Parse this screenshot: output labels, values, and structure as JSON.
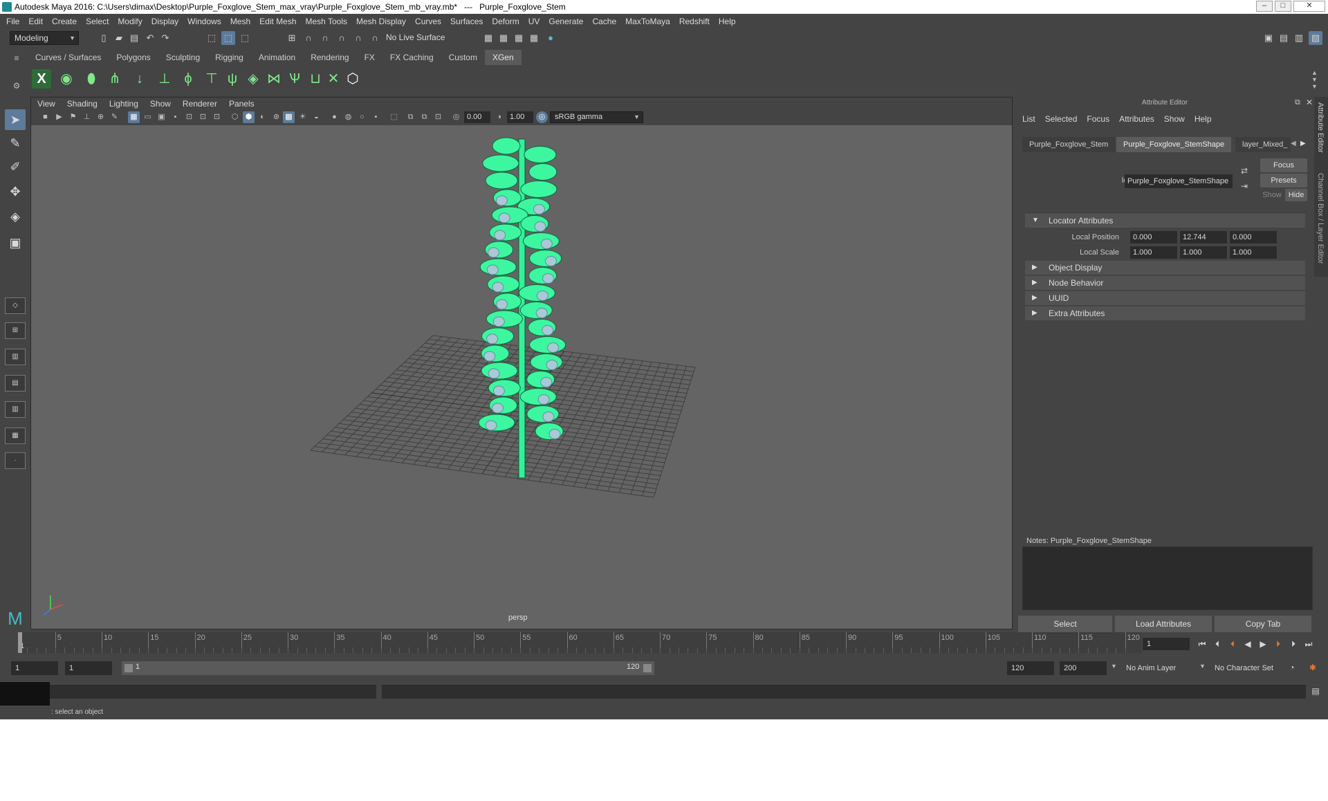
{
  "titlebar": {
    "title": "Autodesk Maya 2016: C:\\Users\\dimax\\Desktop\\Purple_Foxglove_Stem_max_vray\\Purple_Foxglove_Stem_mb_vray.mb*   ---   Purple_Foxglove_Stem",
    "minimize": "–",
    "maximize": "□",
    "close": "✕"
  },
  "menubar": {
    "items": [
      "File",
      "Edit",
      "Create",
      "Select",
      "Modify",
      "Display",
      "Windows",
      "Mesh",
      "Edit Mesh",
      "Mesh Tools",
      "Mesh Display",
      "Curves",
      "Surfaces",
      "Deform",
      "UV",
      "Generate",
      "Cache",
      "MaxToMaya",
      "Redshift",
      "Help"
    ]
  },
  "statusline": {
    "menuset": "Modeling",
    "live_surface": "No Live Surface"
  },
  "shelf": {
    "tabs": [
      "Curves / Surfaces",
      "Polygons",
      "Sculpting",
      "Rigging",
      "Animation",
      "Rendering",
      "FX",
      "FX Caching",
      "Custom",
      "XGen"
    ],
    "active_tab": "XGen"
  },
  "viewport": {
    "menu": [
      "View",
      "Shading",
      "Lighting",
      "Show",
      "Renderer",
      "Panels"
    ],
    "exposure": "0.00",
    "gamma": "1.00",
    "color_space": "sRGB gamma",
    "camera": "persp"
  },
  "attribute_editor": {
    "title": "Attribute Editor",
    "menu": [
      "List",
      "Selected",
      "Focus",
      "Attributes",
      "Show",
      "Help"
    ],
    "tabs": [
      "Purple_Foxglove_Stem",
      "Purple_Foxglove_StemShape",
      "layer_Mixed_"
    ],
    "active_tab": "Purple_Foxglove_StemShape",
    "node_label": "locator:",
    "node_name": "Purple_Foxglove_StemShape",
    "focus": "Focus",
    "presets": "Presets",
    "show": "Show",
    "hide": "Hide",
    "sections": {
      "locator": "Locator Attributes",
      "object_display": "Object Display",
      "node_behavior": "Node Behavior",
      "uuid": "UUID",
      "extra": "Extra Attributes"
    },
    "local_position": {
      "label": "Local Position",
      "x": "0.000",
      "y": "12.744",
      "z": "0.000"
    },
    "local_scale": {
      "label": "Local Scale",
      "x": "1.000",
      "y": "1.000",
      "z": "1.000"
    },
    "notes_label": "Notes:  Purple_Foxglove_StemShape",
    "buttons": {
      "select": "Select",
      "load": "Load Attributes",
      "copy": "Copy Tab"
    }
  },
  "side_tabs": [
    "Attribute Editor",
    "Channel Box / Layer Editor"
  ],
  "timeline": {
    "ticks": [
      "1",
      "5",
      "10",
      "15",
      "20",
      "25",
      "30",
      "35",
      "40",
      "45",
      "50",
      "55",
      "60",
      "65",
      "70",
      "75",
      "80",
      "85",
      "90",
      "95",
      "100",
      "105",
      "110",
      "115",
      "120"
    ],
    "current_frame": "1"
  },
  "range": {
    "start": "1",
    "anim_start": "1",
    "slider_start": "1",
    "slider_end": "120",
    "anim_end_field": "120",
    "end": "200",
    "anim_layer": "No Anim Layer",
    "char_set": "No Character Set"
  },
  "helpline": ": select an object"
}
